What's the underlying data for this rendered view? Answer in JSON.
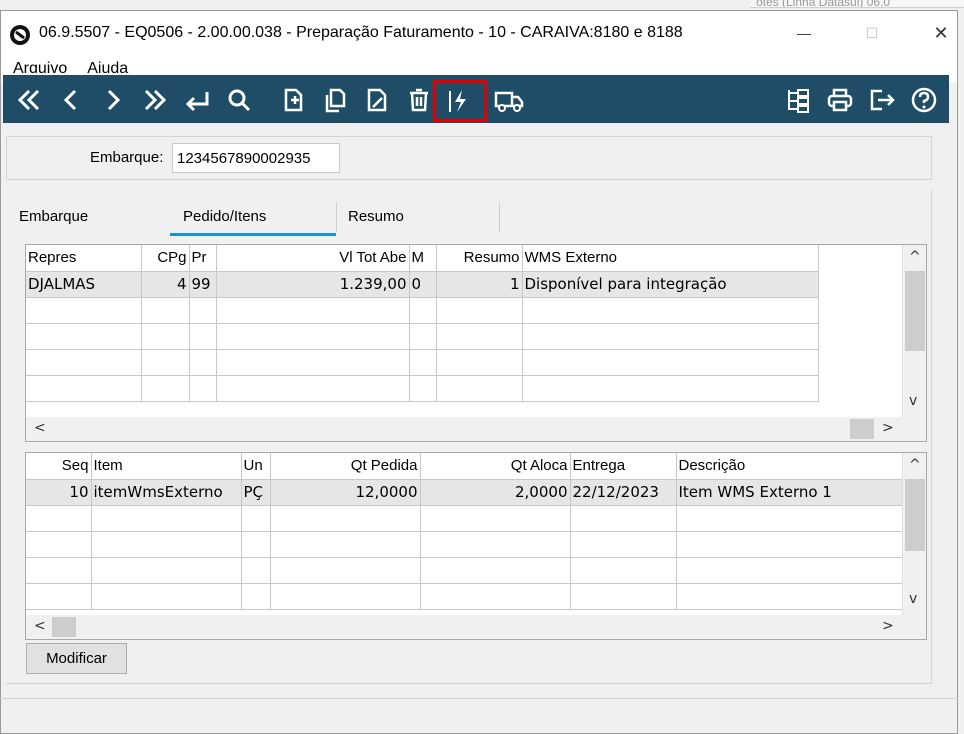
{
  "background_window": {
    "text": "otes (Linha Datasul) 06.0"
  },
  "window": {
    "title": "06.9.5507 - EQ0506 - 2.00.00.038 - Preparação Faturamento - 10 - CARAIVA:8180 e 8188",
    "controls": {
      "minimize": "—",
      "maximize": "☐",
      "close": "✕"
    }
  },
  "menu": [
    "Arquivo",
    "Ajuda"
  ],
  "toolbar": {
    "buttons": [
      "first",
      "previous",
      "next",
      "last",
      "go-to",
      "search",
      "new",
      "copy",
      "edit",
      "delete",
      "execute",
      "shipment"
    ],
    "right_buttons": [
      "tree",
      "print",
      "exit",
      "help"
    ],
    "highlight_color": "#e00000",
    "background": "#1f4c66"
  },
  "embarque": {
    "label": "Embarque:",
    "value": "1234567890002935"
  },
  "tabs": [
    {
      "label": "Embarque",
      "active": false
    },
    {
      "label": "Pedido/Itens",
      "active": true
    },
    {
      "label": "Resumo",
      "active": false
    }
  ],
  "grid_pedidos": {
    "columns": [
      "Repres",
      "CPg",
      "Pr",
      "Vl Tot Abe",
      "M",
      "Resumo",
      "WMS Externo"
    ],
    "rows": [
      [
        "DJALMAS",
        "4",
        "99",
        "1.239,00",
        "0",
        "1",
        "Disponível para integração"
      ]
    ]
  },
  "grid_itens": {
    "columns": [
      "Seq",
      "Item",
      "Un",
      "Qt Pedida",
      "Qt Aloca",
      "Entrega",
      "Descrição"
    ],
    "rows": [
      [
        "10",
        "itemWmsExterno",
        "PÇ",
        "12,0000",
        "2,0000",
        "22/12/2023",
        "Item WMS Externo 1"
      ]
    ]
  },
  "buttons": {
    "modificar": "Modificar"
  },
  "scroll_arrows": {
    "up": "^",
    "down": "v",
    "left": "<",
    "right": ">"
  }
}
